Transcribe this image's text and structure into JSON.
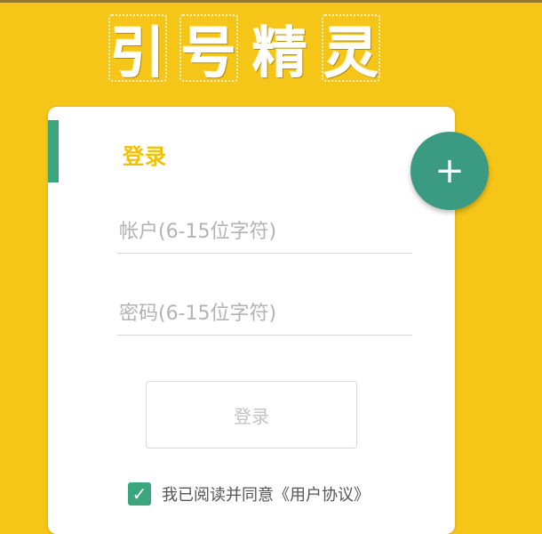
{
  "app": {
    "logo_chars": [
      "引",
      "号",
      "精",
      "灵"
    ]
  },
  "login": {
    "title": "登录",
    "account_placeholder": "帐户(6-15位字符)",
    "password_placeholder": "密码(6-15位字符)",
    "account_value": "",
    "password_value": "",
    "submit_label": "登录"
  },
  "agreement": {
    "checked": true,
    "checkmark": "✓",
    "text": "我已阅读并同意《用户协议》"
  },
  "fab": {
    "symbol": "+",
    "icon": "plus-icon"
  },
  "colors": {
    "background": "#F5C518",
    "accent_green": "#3BA57E",
    "title_yellow": "#F2C200"
  }
}
